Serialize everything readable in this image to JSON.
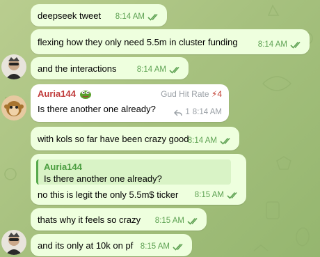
{
  "colors": {
    "outgoing_bubble": "#eeffde",
    "incoming_bubble": "#ffffff",
    "sender_name": "#c03a3a",
    "reply_name": "#4a9d3f",
    "time_outgoing": "#5ea253",
    "time_incoming": "#9aa0a6",
    "rank_number": "#c0392b"
  },
  "messages": [
    {
      "text": "deepseek tweet",
      "time": "8:14 AM"
    },
    {
      "text": "flexing how they only need 5.5m in cluster funding",
      "time": "8:14 AM"
    },
    {
      "text": "and the interactions",
      "time": "8:14 AM"
    },
    {
      "sender": "Auria144",
      "rank_label": "Gud Hit Rate",
      "rank_number": "4",
      "text": "Is there another one already?",
      "reply_count": "1",
      "time": "8:14 AM"
    },
    {
      "text": "with kols so far have been crazy good",
      "time": "8:14 AM"
    },
    {
      "reply_to": {
        "name": "Auria144",
        "text": "Is there another one already?"
      },
      "text": "no this is legit the only 5.5m$ ticker",
      "time": "8:15 AM"
    },
    {
      "text": "thats why it feels so crazy",
      "time": "8:15 AM"
    },
    {
      "text": "and its only at 10k on pf",
      "time": "8:15 AM"
    }
  ]
}
